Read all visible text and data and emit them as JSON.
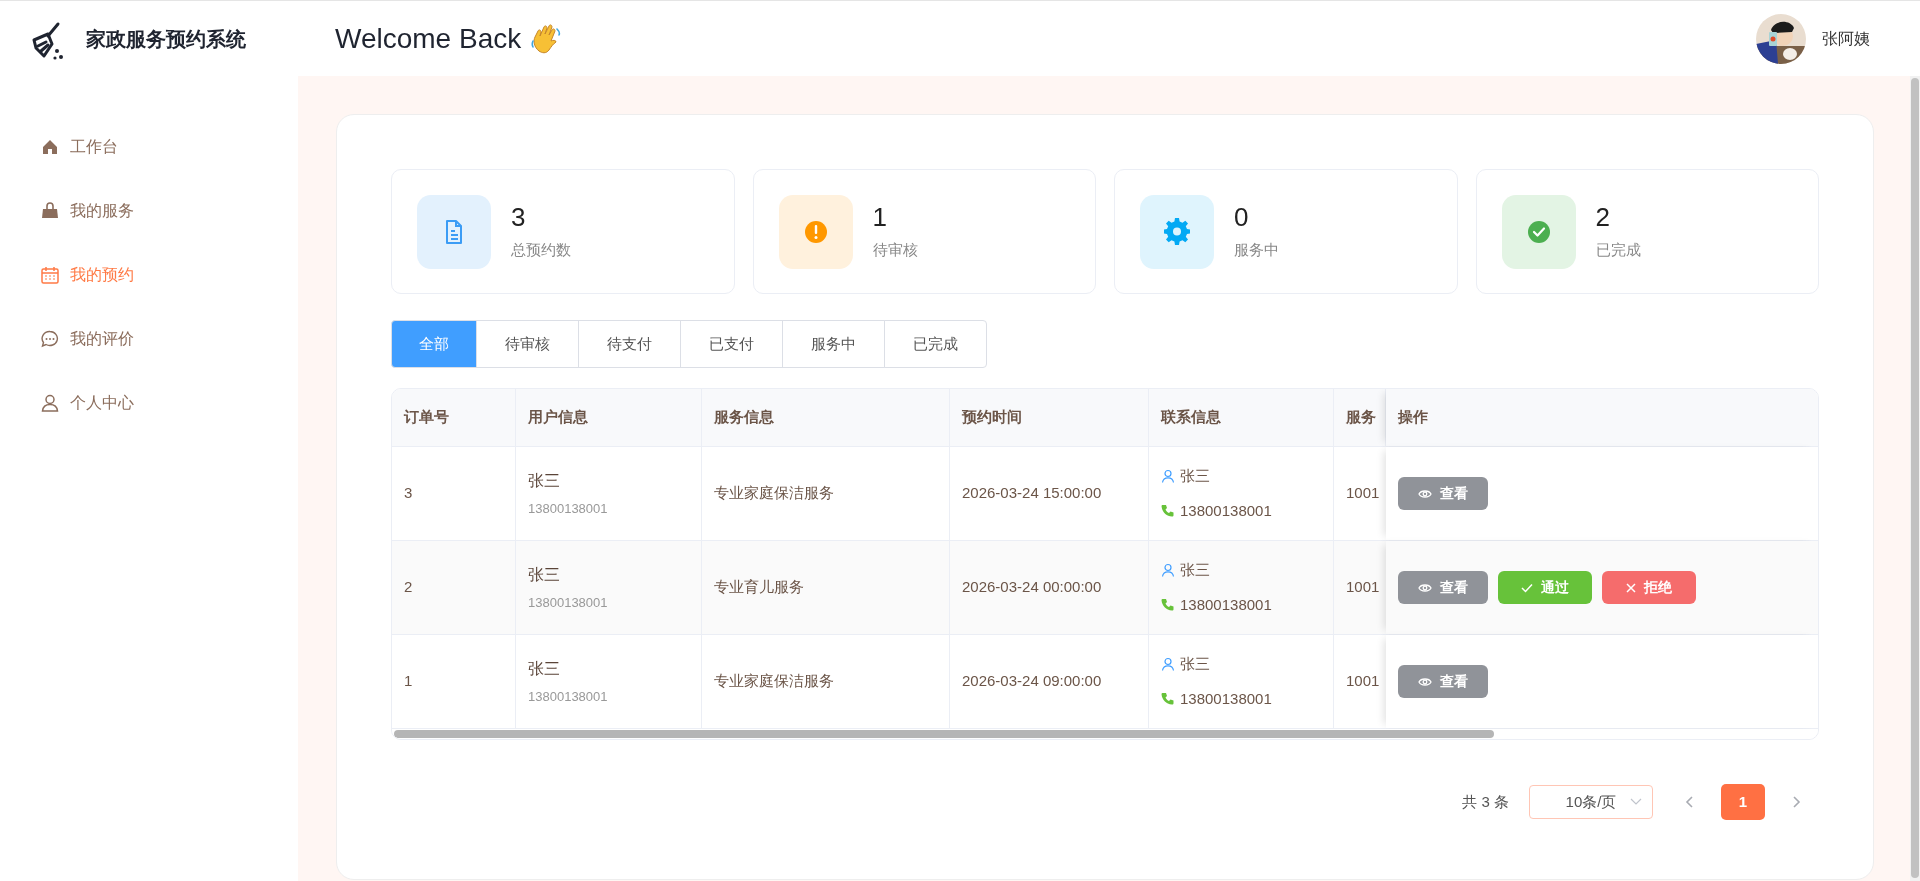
{
  "brand": {
    "title": "家政服务预约系统"
  },
  "header": {
    "greeting": "Welcome Back",
    "user": {
      "name": "张阿姨"
    }
  },
  "sidebar": {
    "items": [
      {
        "label": "工作台",
        "kind": "home",
        "selected": false
      },
      {
        "label": "我的服务",
        "kind": "bag",
        "selected": false
      },
      {
        "label": "我的预约",
        "kind": "calendar",
        "selected": true
      },
      {
        "label": "我的评价",
        "kind": "chat",
        "selected": false
      },
      {
        "label": "个人中心",
        "kind": "user",
        "selected": false
      }
    ]
  },
  "stats": [
    {
      "value": "3",
      "label": "总预约数",
      "kind": "document",
      "color": "#3b9cf5"
    },
    {
      "value": "1",
      "label": "待审核",
      "kind": "alert",
      "color": "#ff9800"
    },
    {
      "value": "0",
      "label": "服务中",
      "kind": "gear",
      "color": "#03a9f4"
    },
    {
      "value": "2",
      "label": "已完成",
      "kind": "check",
      "color": "#4caf50"
    }
  ],
  "tabs": [
    {
      "label": "全部",
      "selected": true
    },
    {
      "label": "待审核",
      "selected": false
    },
    {
      "label": "待支付",
      "selected": false
    },
    {
      "label": "已支付",
      "selected": false
    },
    {
      "label": "服务中",
      "selected": false
    },
    {
      "label": "已完成",
      "selected": false
    }
  ],
  "table": {
    "columns": [
      "订单号",
      "用户信息",
      "服务信息",
      "预约时间",
      "联系信息",
      "服务",
      "操作"
    ],
    "rows": [
      {
        "order_id": "3",
        "user_name": "张三",
        "user_phone": "13800138001",
        "service": "专业家庭保洁服务",
        "time": "2026-03-24 15:00:00",
        "contact_name": "张三",
        "contact_phone": "13800138001",
        "address": "1001",
        "actions": [
          {
            "kind": "view",
            "label": "查看"
          }
        ]
      },
      {
        "order_id": "2",
        "user_name": "张三",
        "user_phone": "13800138001",
        "service": "专业育儿服务",
        "time": "2026-03-24 00:00:00",
        "contact_name": "张三",
        "contact_phone": "13800138001",
        "address": "1001",
        "actions": [
          {
            "kind": "view",
            "label": "查看"
          },
          {
            "kind": "approve",
            "label": "通过"
          },
          {
            "kind": "reject",
            "label": "拒绝"
          }
        ]
      },
      {
        "order_id": "1",
        "user_name": "张三",
        "user_phone": "13800138001",
        "service": "专业家庭保洁服务",
        "time": "2026-03-24 09:00:00",
        "contact_name": "张三",
        "contact_phone": "13800138001",
        "address": "1001",
        "actions": [
          {
            "kind": "view",
            "label": "查看"
          }
        ]
      }
    ]
  },
  "pagination": {
    "total": "共 3 条",
    "page_size": "10条/页",
    "pages": [
      {
        "label": "1",
        "selected": true
      }
    ]
  }
}
